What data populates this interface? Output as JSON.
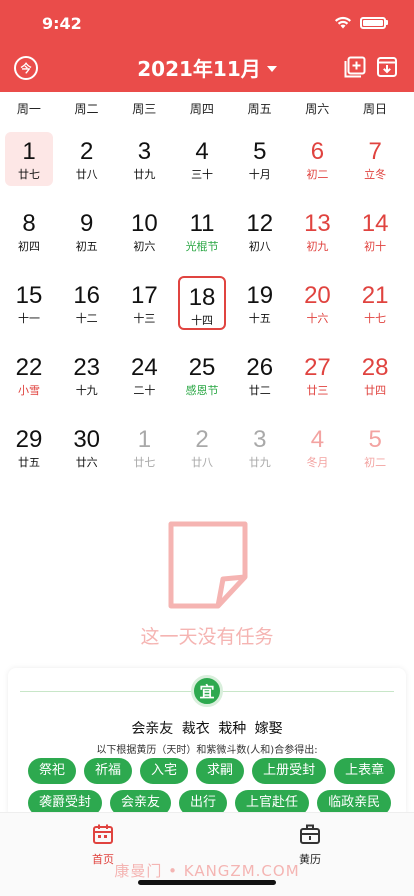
{
  "status": {
    "time": "9:42"
  },
  "header": {
    "title": "2021年11月",
    "today_glyph": "今"
  },
  "weekdays": [
    "周一",
    "周二",
    "周三",
    "周四",
    "周五",
    "周六",
    "周日"
  ],
  "calendar": {
    "weeks": [
      [
        {
          "day": "1",
          "sub": "廿七",
          "color": "black",
          "today": true
        },
        {
          "day": "2",
          "sub": "廿八",
          "color": "black"
        },
        {
          "day": "3",
          "sub": "廿九",
          "color": "black"
        },
        {
          "day": "4",
          "sub": "三十",
          "color": "black"
        },
        {
          "day": "5",
          "sub": "十月",
          "color": "black"
        },
        {
          "day": "6",
          "sub": "初二",
          "color": "red"
        },
        {
          "day": "7",
          "sub": "立冬",
          "color": "red"
        }
      ],
      [
        {
          "day": "8",
          "sub": "初四",
          "color": "black"
        },
        {
          "day": "9",
          "sub": "初五",
          "color": "black"
        },
        {
          "day": "10",
          "sub": "初六",
          "color": "black"
        },
        {
          "day": "11",
          "sub": "光棍节",
          "color": "green"
        },
        {
          "day": "12",
          "sub": "初八",
          "color": "black"
        },
        {
          "day": "13",
          "sub": "初九",
          "color": "red"
        },
        {
          "day": "14",
          "sub": "初十",
          "color": "red"
        }
      ],
      [
        {
          "day": "15",
          "sub": "十一",
          "color": "black"
        },
        {
          "day": "16",
          "sub": "十二",
          "color": "black"
        },
        {
          "day": "17",
          "sub": "十三",
          "color": "black"
        },
        {
          "day": "18",
          "sub": "十四",
          "color": "black",
          "selected": true
        },
        {
          "day": "19",
          "sub": "十五",
          "color": "black"
        },
        {
          "day": "20",
          "sub": "十六",
          "color": "red"
        },
        {
          "day": "21",
          "sub": "十七",
          "color": "red"
        }
      ],
      [
        {
          "day": "22",
          "sub": "小雪",
          "color": "redsub"
        },
        {
          "day": "23",
          "sub": "十九",
          "color": "black"
        },
        {
          "day": "24",
          "sub": "二十",
          "color": "black"
        },
        {
          "day": "25",
          "sub": "感恩节",
          "color": "green"
        },
        {
          "day": "26",
          "sub": "廿二",
          "color": "black"
        },
        {
          "day": "27",
          "sub": "廿三",
          "color": "red"
        },
        {
          "day": "28",
          "sub": "廿四",
          "color": "red"
        }
      ],
      [
        {
          "day": "29",
          "sub": "廿五",
          "color": "black"
        },
        {
          "day": "30",
          "sub": "廿六",
          "color": "black"
        },
        {
          "day": "1",
          "sub": "廿七",
          "color": "gray"
        },
        {
          "day": "2",
          "sub": "廿八",
          "color": "gray"
        },
        {
          "day": "3",
          "sub": "廿九",
          "color": "gray"
        },
        {
          "day": "4",
          "sub": "冬月",
          "color": "pink"
        },
        {
          "day": "5",
          "sub": "初二",
          "color": "pink"
        }
      ]
    ]
  },
  "empty": {
    "text": "这一天没有任务"
  },
  "almanac": {
    "badge": "宜",
    "main": "会亲友  裁衣  栽种  嫁娶",
    "note": "以下根据黄历（天时）和紫微斗数(人和)合参得出:",
    "tags": [
      "祭祀",
      "祈福",
      "入宅",
      "求嗣",
      "上册受封",
      "上表章",
      "袭爵受封",
      "会亲友",
      "出行",
      "上官赴任",
      "临政亲民"
    ]
  },
  "tabs": {
    "home": "首页",
    "almanac": "黄历"
  },
  "watermark": "康曼门 • KANGZM.COM",
  "colors": {
    "brand": "#ea4c4a",
    "green": "#2da94f",
    "weekend": "#e0433f"
  }
}
